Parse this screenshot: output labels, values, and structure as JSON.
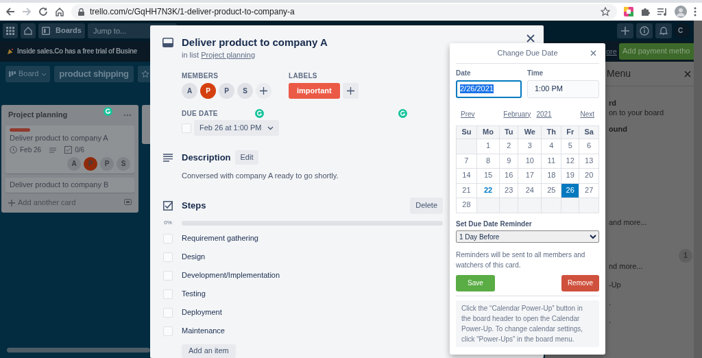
{
  "browser": {
    "url": "trello.com/c/GqHH7N3K/1-deliver-product-to-company-a"
  },
  "header": {
    "boards": "Boards",
    "search": {
      "placeholder": "Jump to..."
    },
    "avatar": "C"
  },
  "banner": {
    "text": "Inside sales.Co has a free trial of Busine",
    "link": "ore",
    "button": "Add payment metho"
  },
  "board_header": {
    "view": "Board",
    "title": "product shipping"
  },
  "list": {
    "title": "Project planning",
    "cards": [
      {
        "title": "Deliver product to company A",
        "labels": [
          {
            "color": "#8f3a2e"
          }
        ],
        "due": "Feb 26",
        "checklist": "0/6",
        "members": [
          {
            "initial": "A",
            "color": "#7f8286"
          },
          {
            "initial": "P",
            "color": "#8f2a0b"
          },
          {
            "initial": "P",
            "color": "#7f8286"
          },
          {
            "initial": "S",
            "color": "#7f8286"
          }
        ]
      },
      {
        "title": "Deliver product to company B"
      }
    ],
    "add_card": "Add another card"
  },
  "menu_panel": {
    "title": "Menu",
    "fragments": [
      "rd",
      "on to your board",
      "ound",
      "and more...",
      "nd more...",
      "-Up",
      ".",
      "."
    ],
    "badge": "1"
  },
  "card_modal": {
    "title": "Deliver product to company A",
    "list_prefix": "in list",
    "list_name": "Project planning",
    "members_label": "MEMBERS",
    "members": [
      {
        "initial": "A",
        "color": "#dfe1e6"
      },
      {
        "initial": "P",
        "color": "#d4400f"
      },
      {
        "initial": "P",
        "color": "#dfe1e6"
      },
      {
        "initial": "S",
        "color": "#dfe1e6"
      }
    ],
    "labels_label": "LABELS",
    "labels": [
      {
        "text": "important",
        "color": "#eb5a46"
      }
    ],
    "due_label": "DUE DATE",
    "due": {
      "text": "Feb 26 at 1:00 PM",
      "complete": false
    },
    "description": {
      "title": "Description",
      "edit": "Edit",
      "text": "Conversed with company A ready to go shortly."
    },
    "checklist": {
      "title": "Steps",
      "delete": "Delete",
      "percent": "0%",
      "level": 0,
      "items": [
        {
          "text": "Requirement gathering",
          "checked": false
        },
        {
          "text": "Design",
          "checked": false
        },
        {
          "text": "Development/Implementation",
          "checked": false
        },
        {
          "text": "Testing",
          "checked": false
        },
        {
          "text": "Deployment",
          "checked": false
        },
        {
          "text": "Maintenance",
          "checked": false
        }
      ],
      "add_item": "Add an item"
    }
  },
  "due_popover": {
    "title": "Change Due Date",
    "date_label": "Date",
    "date": "2/26/2021",
    "time_label": "Time",
    "time": "1:00 PM",
    "prev": "Prev",
    "month": "February",
    "year": "2021",
    "next": "Next",
    "weekdays": [
      "Su",
      "Mo",
      "Tu",
      "We",
      "Th",
      "Fr",
      "Sa"
    ],
    "weeks": [
      [
        {
          "kind": "blank"
        },
        {
          "kind": "day",
          "day": "1",
          "selected": false,
          "today": false
        },
        {
          "kind": "day",
          "day": "2",
          "selected": false,
          "today": false
        },
        {
          "kind": "day",
          "day": "3",
          "selected": false,
          "today": false
        },
        {
          "kind": "day",
          "day": "4",
          "selected": false,
          "today": false
        },
        {
          "kind": "day",
          "day": "5",
          "selected": false,
          "today": false
        },
        {
          "kind": "day",
          "day": "6",
          "selected": false,
          "today": false
        }
      ],
      [
        {
          "kind": "day",
          "day": "7",
          "selected": false,
          "today": false
        },
        {
          "kind": "day",
          "day": "8",
          "selected": false,
          "today": false
        },
        {
          "kind": "day",
          "day": "9",
          "selected": false,
          "today": false
        },
        {
          "kind": "day",
          "day": "10",
          "selected": false,
          "today": false
        },
        {
          "kind": "day",
          "day": "11",
          "selected": false,
          "today": false
        },
        {
          "kind": "day",
          "day": "12",
          "selected": false,
          "today": false
        },
        {
          "kind": "day",
          "day": "13",
          "selected": false,
          "today": false
        }
      ],
      [
        {
          "kind": "day",
          "day": "14",
          "selected": false,
          "today": false
        },
        {
          "kind": "day",
          "day": "15",
          "selected": false,
          "today": false
        },
        {
          "kind": "day",
          "day": "16",
          "selected": false,
          "today": false
        },
        {
          "kind": "day",
          "day": "17",
          "selected": false,
          "today": false
        },
        {
          "kind": "day",
          "day": "18",
          "selected": false,
          "today": false
        },
        {
          "kind": "day",
          "day": "19",
          "selected": false,
          "today": false
        },
        {
          "kind": "day",
          "day": "20",
          "selected": false,
          "today": false
        }
      ],
      [
        {
          "kind": "day",
          "day": "21",
          "selected": false,
          "today": false
        },
        {
          "kind": "day",
          "day": "22",
          "selected": false,
          "today": true
        },
        {
          "kind": "day",
          "day": "23",
          "selected": false,
          "today": false
        },
        {
          "kind": "day",
          "day": "24",
          "selected": false,
          "today": false
        },
        {
          "kind": "day",
          "day": "25",
          "selected": false,
          "today": false
        },
        {
          "kind": "day",
          "day": "26",
          "selected": true,
          "today": false
        },
        {
          "kind": "day",
          "day": "27",
          "selected": false,
          "today": false
        }
      ],
      [
        {
          "kind": "day",
          "day": "28",
          "selected": false,
          "today": false
        },
        {
          "kind": "blank"
        },
        {
          "kind": "blank"
        },
        {
          "kind": "blank"
        },
        {
          "kind": "blank"
        },
        {
          "kind": "blank"
        },
        {
          "kind": "blank"
        }
      ]
    ],
    "reminder_label": "Set Due Date Reminder",
    "reminder": "1 Day Before",
    "reminder_note": "Reminders will be sent to all members and watchers of this card.",
    "save": "Save",
    "remove": "Remove",
    "footer": "Click the “Calendar Power-Up” button in the board header to open the Calendar Power-Up. To change calendar settings, click “Power-Ups” in the board menu."
  }
}
